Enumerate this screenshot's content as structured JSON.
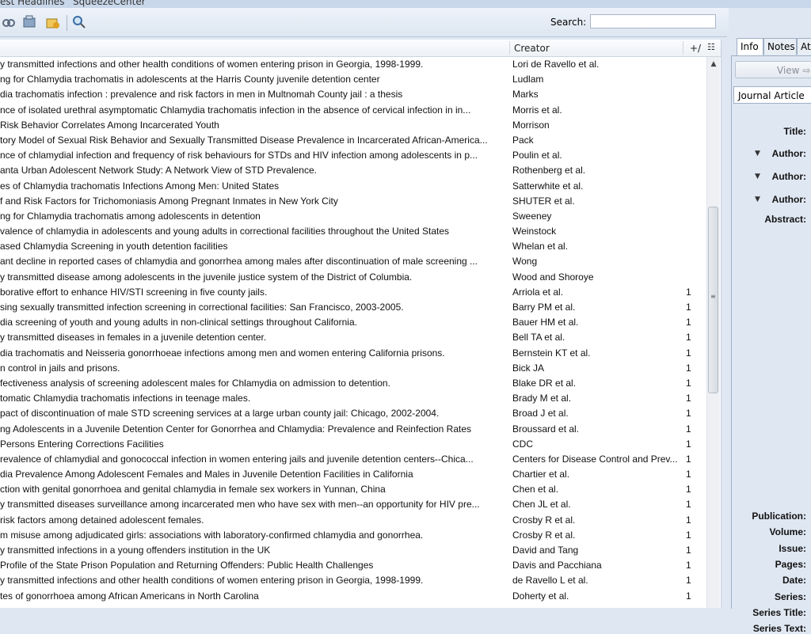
{
  "window": {
    "title": "est Headlines",
    "group": "SqueezeCenter"
  },
  "search": {
    "label": "Search:",
    "value": ""
  },
  "columns": {
    "creator": "Creator",
    "count": "+/"
  },
  "rows": [
    {
      "title": "y transmitted infections and other health conditions of women entering prison in Georgia, 1998-1999.",
      "creator": "Lori de Ravello et al.",
      "count": ""
    },
    {
      "title": "ng for Chlamydia trachomatis in adolescents at the Harris County juvenile detention center",
      "creator": "Ludlam",
      "count": ""
    },
    {
      "title": "dia trachomatis infection : prevalence and risk factors in men in Multnomah County jail : a thesis",
      "creator": "Marks",
      "count": ""
    },
    {
      "title": "nce of isolated urethral asymptomatic Chlamydia trachomatis infection in the absence of cervical infection in in...",
      "creator": "Morris et al.",
      "count": ""
    },
    {
      "title": "Risk Behavior Correlates Among Incarcerated Youth",
      "creator": "Morrison",
      "count": ""
    },
    {
      "title": "tory Model of Sexual Risk Behavior and Sexually Transmitted Disease Prevalence in Incarcerated African-America...",
      "creator": "Pack",
      "count": ""
    },
    {
      "title": "nce of chlamydial infection and frequency of risk behaviours for STDs and HIV infection among adolescents in p...",
      "creator": "Poulin et al.",
      "count": ""
    },
    {
      "title": "anta Urban Adolescent Network Study: A Network View of STD Prevalence.",
      "creator": "Rothenberg et al.",
      "count": ""
    },
    {
      "title": "es of Chlamydia trachomatis Infections Among Men: United States",
      "creator": "Satterwhite et al.",
      "count": ""
    },
    {
      "title": "f and Risk Factors for Trichomoniasis Among Pregnant Inmates in New York City",
      "creator": "SHUTER et al.",
      "count": ""
    },
    {
      "title": "ng for Chlamydia trachomatis among adolescents in detention",
      "creator": "Sweeney",
      "count": ""
    },
    {
      "title": "valence of chlamydia in adolescents and young adults in correctional facilities throughout the United States",
      "creator": "Weinstock",
      "count": ""
    },
    {
      "title": "ased Chlamydia Screening in youth detention facilities",
      "creator": "Whelan et al.",
      "count": ""
    },
    {
      "title": "ant decline in reported cases of chlamydia and gonorrhea among males after discontinuation of male screening ...",
      "creator": "Wong",
      "count": ""
    },
    {
      "title": "y transmitted disease among adolescents in the juvenile justice system of the District of Columbia.",
      "creator": "Wood and Shoroye",
      "count": ""
    },
    {
      "title": "borative effort to enhance HIV/STI screening in five county jails.",
      "creator": "Arriola et al.",
      "count": "1"
    },
    {
      "title": "sing sexually transmitted infection screening in correctional facilities: San Francisco, 2003-2005.",
      "creator": "Barry PM et al.",
      "count": "1"
    },
    {
      "title": "dia screening of youth and young adults in non-clinical settings throughout California.",
      "creator": "Bauer HM et al.",
      "count": "1"
    },
    {
      "title": "y transmitted diseases in females in a juvenile detention center.",
      "creator": "Bell TA et al.",
      "count": "1"
    },
    {
      "title": "dia trachomatis and Neisseria gonorrhoeae infections among men and women entering California prisons.",
      "creator": "Bernstein KT et al.",
      "count": "1"
    },
    {
      "title": "n control in jails and prisons.",
      "creator": "Bick JA",
      "count": "1"
    },
    {
      "title": "fectiveness analysis of screening adolescent males for Chlamydia on admission to detention.",
      "creator": "Blake DR et al.",
      "count": "1"
    },
    {
      "title": "tomatic Chlamydia trachomatis infections in teenage males.",
      "creator": "Brady M et al.",
      "count": "1"
    },
    {
      "title": "pact of discontinuation of male STD screening services at a large urban county jail: Chicago, 2002-2004.",
      "creator": "Broad J et al.",
      "count": "1"
    },
    {
      "title": "ng Adolescents in a Juvenile Detention Center for Gonorrhea and Chlamydia: Prevalence and Reinfection Rates",
      "creator": "Broussard et al.",
      "count": "1"
    },
    {
      "title": "Persons Entering Corrections Facilities",
      "creator": "CDC",
      "count": "1"
    },
    {
      "title": "revalence of chlamydial and gonococcal infection in women entering jails and juvenile detention centers--Chica...",
      "creator": "Centers for Disease Control and Prev...",
      "count": "1"
    },
    {
      "title": "dia Prevalence Among Adolescent Females and Males in Juvenile Detention Facilities in California",
      "creator": "Chartier et al.",
      "count": "1"
    },
    {
      "title": "ction with genital gonorrhoea and genital chlamydia in female sex workers in Yunnan, China",
      "creator": "Chen et al.",
      "count": "1"
    },
    {
      "title": "y transmitted diseases surveillance among incarcerated men who have sex with men--an opportunity for HIV pre...",
      "creator": "Chen JL et al.",
      "count": "1"
    },
    {
      "title": "risk factors among detained adolescent females.",
      "creator": "Crosby R et al.",
      "count": "1"
    },
    {
      "title": "m misuse among adjudicated girls: associations with laboratory-confirmed chlamydia and gonorrhea.",
      "creator": "Crosby R et al.",
      "count": "1"
    },
    {
      "title": "y transmitted infections in a young offenders institution in the UK",
      "creator": "David and Tang",
      "count": "1"
    },
    {
      "title": "Profile of the State Prison Population and Returning Offenders: Public Health Challenges",
      "creator": "Davis and Pacchiana",
      "count": "1"
    },
    {
      "title": "y transmitted infections and other health conditions of women entering prison in Georgia, 1998-1999.",
      "creator": "de Ravello L et al.",
      "count": "1"
    },
    {
      "title": "tes of gonorrhoea among African Americans in North Carolina",
      "creator": "Doherty et al.",
      "count": "1"
    }
  ],
  "info_pane": {
    "tabs": [
      "Info",
      "Notes",
      "At"
    ],
    "view_button": "View",
    "item_type": "Journal Article",
    "fields_top": [
      {
        "label": "Title:",
        "twisty": false
      },
      {
        "label": "Author:",
        "twisty": true
      },
      {
        "label": "Author:",
        "twisty": true
      },
      {
        "label": "Author:",
        "twisty": true
      },
      {
        "label": "Abstract:",
        "twisty": false
      }
    ],
    "fields_bottom": [
      "Publication:",
      "Volume:",
      "Issue:",
      "Pages:",
      "Date:",
      "Series:",
      "Series Title:",
      "Series Text:"
    ]
  },
  "colors": {
    "background": "#dfe7f2",
    "list_bg": "#ffffff",
    "toolbar": "#e7edf6"
  },
  "icons": [
    "link-icon",
    "new-item-icon",
    "attachment-icon",
    "find-icon"
  ]
}
